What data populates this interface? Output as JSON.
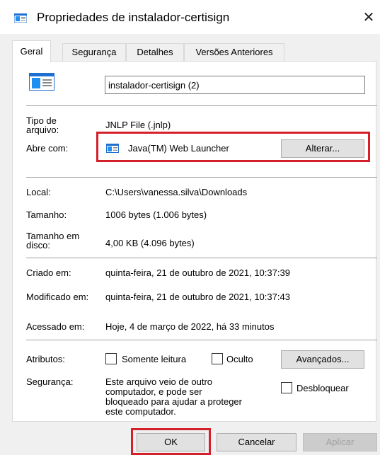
{
  "window": {
    "title": "Propriedades de instalador-certisign",
    "close_glyph": "✕"
  },
  "tabs": [
    {
      "label": "Geral",
      "active": true
    },
    {
      "label": "Segurança",
      "active": false
    },
    {
      "label": "Detalhes",
      "active": false
    },
    {
      "label": "Versões Anteriores",
      "active": false
    }
  ],
  "file": {
    "name": "instalador-certisign (2)",
    "icon": "file-icon"
  },
  "type_section": {
    "type_label": "Tipo de arquivo:",
    "type_value": "JNLP File (.jnlp)",
    "opens_with_label": "Abre com:",
    "opens_with_value": "Java(TM) Web Launcher",
    "change_button": "Alterar..."
  },
  "location_section": {
    "location_label": "Local:",
    "location_value": "C:\\Users\\vanessa.silva\\Downloads",
    "size_label": "Tamanho:",
    "size_value": "1006 bytes (1.006 bytes)",
    "disk_size_label": "Tamanho em disco:",
    "disk_size_value": "4,00 KB (4.096 bytes)"
  },
  "dates_section": {
    "created_label": "Criado em:",
    "created_value": "quinta-feira, 21 de outubro de 2021, 10:37:39",
    "modified_label": "Modificado em:",
    "modified_value": "quinta-feira, 21 de outubro de 2021, 10:37:43",
    "accessed_label": "Acessado em:",
    "accessed_value": "Hoje, 4 de março de 2022, há 33 minutos"
  },
  "attributes_section": {
    "attributes_label": "Atributos:",
    "readonly_label": "Somente leitura",
    "hidden_label": "Oculto",
    "advanced_button": "Avançados...",
    "security_label": "Segurança:",
    "security_text": "Este arquivo veio de outro computador, e pode ser bloqueado para ajudar a proteger este computador.",
    "unblock_label": "Desbloquear"
  },
  "footer": {
    "ok": "OK",
    "cancel": "Cancelar",
    "apply": "Aplicar"
  },
  "colors": {
    "highlight": "#d4202a",
    "window_bg": "#f0f0f0",
    "panel_bg": "#ffffff"
  }
}
